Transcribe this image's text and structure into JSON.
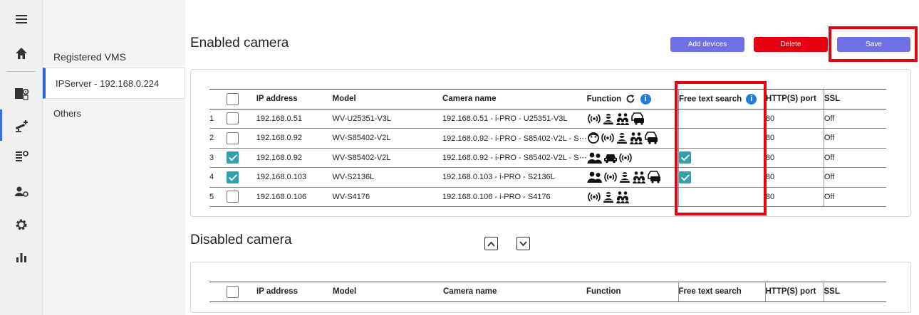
{
  "vms_panel": {
    "title": "Registered VMS",
    "items": [
      {
        "label": "IPServer - 192.168.0.224"
      },
      {
        "label": "Others"
      }
    ]
  },
  "enabled": {
    "title": "Enabled camera",
    "add_label": "Add devices",
    "delete_label": "Delete",
    "save_label": "Save",
    "headers": {
      "ip": "IP address",
      "model": "Model",
      "name": "Camera name",
      "function": "Function",
      "free_text": "Free text search",
      "port": "HTTP(S) port",
      "ssl": "SSL"
    },
    "rows": [
      {
        "no": "1",
        "checked": false,
        "ip": "192.168.0.51",
        "model": "WV-U25351-V3L",
        "name": "192.168.0.51 - i-PRO - U25351-V3L",
        "functions": [
          "audio-waves-icon",
          "face-person-icon",
          "people-group-icon",
          "vehicle-icon"
        ],
        "free_text": false,
        "port": "80",
        "ssl": "Off"
      },
      {
        "no": "2",
        "checked": false,
        "ip": "192.168.0.92",
        "model": "WV-S85402-V2L",
        "name": "192.168.0.92 - i-PRO - S85402-V2L - S⋯",
        "functions": [
          "face-icon",
          "audio-waves-icon",
          "face-person-icon",
          "people-group-icon",
          "vehicle-icon"
        ],
        "free_text": false,
        "port": "80",
        "ssl": "Off"
      },
      {
        "no": "3",
        "checked": true,
        "ip": "192.168.0.92",
        "model": "WV-S85402-V2L",
        "name": "192.168.0.92 - i-PRO - S85402-V2L - S⋯",
        "functions": [
          "two-persons-icon",
          "car-icon",
          "audio-waves-icon"
        ],
        "free_text": true,
        "port": "80",
        "ssl": "Off"
      },
      {
        "no": "4",
        "checked": true,
        "ip": "192.168.0.103",
        "model": "WV-S2136L",
        "name": "192.168.0.103 - i-PRO - S2136L",
        "functions": [
          "two-persons-icon",
          "audio-waves-icon",
          "face-person-icon",
          "people-group-icon",
          "vehicle-icon"
        ],
        "free_text": true,
        "port": "80",
        "ssl": "Off"
      },
      {
        "no": "5",
        "checked": false,
        "ip": "192.168.0.106",
        "model": "WV-S4176",
        "name": "192.168.0.106 - i-PRO - S4176",
        "functions": [
          "audio-waves-icon",
          "face-person-icon",
          "people-group-icon"
        ],
        "free_text": false,
        "port": "80",
        "ssl": "Off"
      }
    ]
  },
  "disabled": {
    "title": "Disabled camera",
    "headers": {
      "ip": "IP address",
      "model": "Model",
      "name": "Camera name",
      "function": "Function",
      "free_text": "Free text search",
      "port": "HTTP(S) port",
      "ssl": "SSL"
    }
  },
  "colors": {
    "accent_blue": "#6f6fe6",
    "delete_red": "#e60012",
    "highlight_red": "#e60012",
    "checkbox_checked": "#2fa1b0",
    "active_indicator": "#2f64d8"
  },
  "rail_icons": [
    "menu-icon",
    "home-icon",
    "camera-settings-icon",
    "camera-list-icon",
    "camera-config-icon",
    "user-settings-icon",
    "gear-icon",
    "bar-chart-icon"
  ]
}
